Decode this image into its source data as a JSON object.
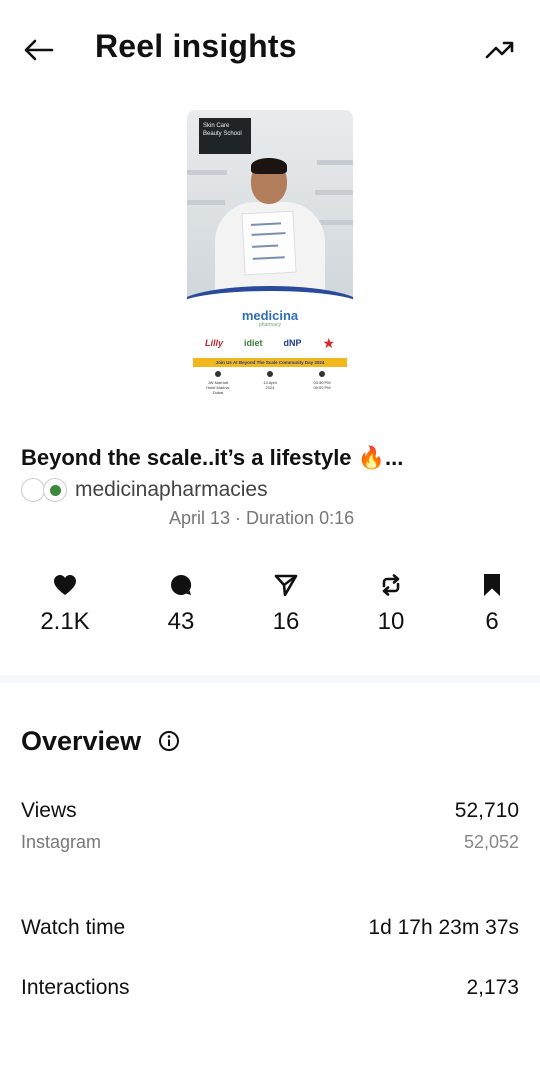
{
  "header": {
    "title": "Reel insights",
    "back_icon": "arrow-left-icon",
    "trend_icon": "trending-up-icon"
  },
  "thumbnail": {
    "sign_text": "Skin Care",
    "sign_sub": "Beauty School",
    "brand": "medicina",
    "brand_sub": "pharmacy",
    "logos": [
      "Lilly",
      "idiet",
      "dNP",
      "★"
    ],
    "banner": "Join Us At Beyond The Scale Community Day 2024",
    "info": [
      {
        "line1": "JW Marriott",
        "line2": "Hotel Marina, Dubai"
      },
      {
        "line1": "13 April",
        "line2": "2024"
      },
      {
        "line1": "03:30 PM",
        "line2": "09:00 PM"
      }
    ]
  },
  "post": {
    "caption": "Beyond the scale..it’s a lifestyle 🔥...",
    "account": "medicinapharmacies",
    "meta": "April 13 · Duration 0:16"
  },
  "stats": [
    {
      "icon": "heart-icon",
      "value": "2.1K"
    },
    {
      "icon": "comment-icon",
      "value": "43"
    },
    {
      "icon": "share-icon",
      "value": "16"
    },
    {
      "icon": "repost-icon",
      "value": "10"
    },
    {
      "icon": "bookmark-icon",
      "value": "6"
    }
  ],
  "overview": {
    "title": "Overview",
    "info_icon": "info-icon",
    "views_label": "Views",
    "views_value": "52,710",
    "instagram_label": "Instagram",
    "instagram_value": "52,052",
    "watch_label": "Watch time",
    "watch_value": "1d 17h 23m 37s",
    "interactions_label": "Interactions",
    "interactions_value": "2,173"
  },
  "colors": {
    "text": "#111111",
    "muted": "#777777",
    "brand_blue": "#2f6fb6",
    "banner_yellow": "#f1b71c"
  }
}
